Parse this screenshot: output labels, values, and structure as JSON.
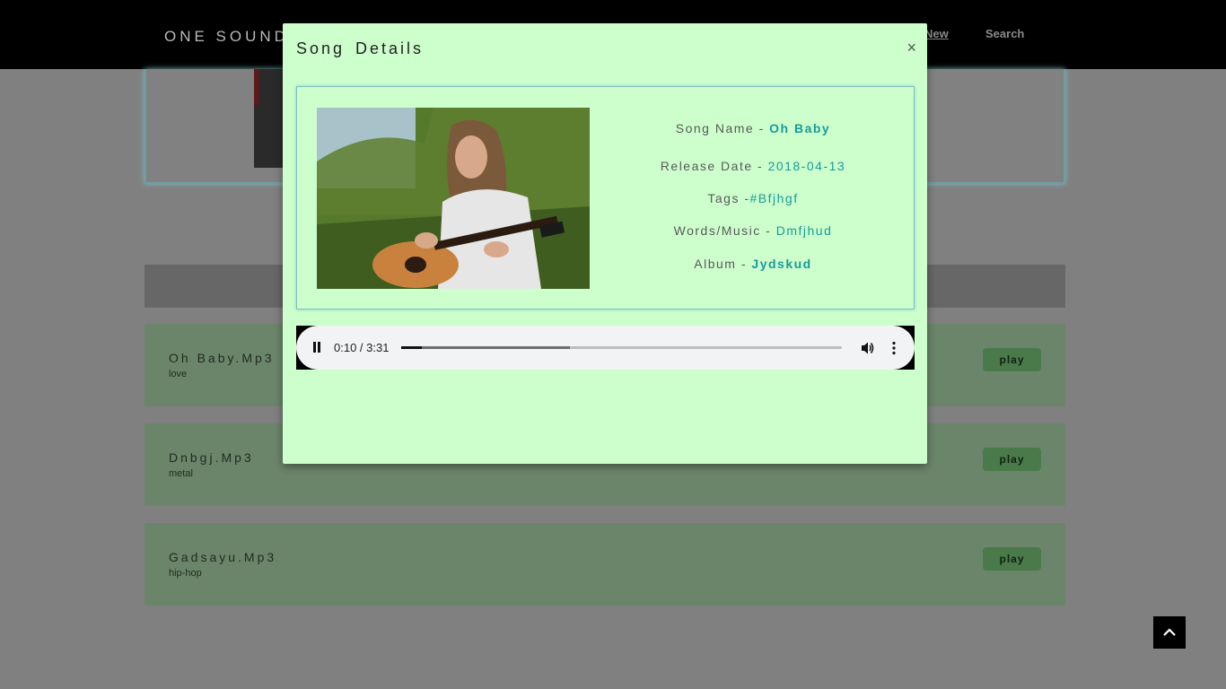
{
  "navbar": {
    "brand": "ONE SOUND",
    "links": [
      "New",
      "Search"
    ]
  },
  "songs": [
    {
      "title": "Oh   Baby.Mp3",
      "tag": "love",
      "button": "play"
    },
    {
      "title": "Dnbgj.Mp3",
      "tag": "metal",
      "button": "play"
    },
    {
      "title": "Gadsayu.Mp3",
      "tag": "hip-hop",
      "button": "play"
    }
  ],
  "modal": {
    "title": "Song  Details",
    "close": "×",
    "song_name_label": "Song Name - ",
    "song_name": "Oh Baby",
    "release_label": "Release Date - ",
    "release_date": "2018-04-13",
    "tags_label": "Tags -",
    "tags": "#Bfjhgf",
    "words_label": "Words/Music - ",
    "words_music": "Dmfjhud",
    "album_label": "Album - ",
    "album": "Jydskud"
  },
  "player": {
    "time": "0:10 / 3:31",
    "progress_fraction": 0.047,
    "buffered_fraction": 0.382
  },
  "icons": {
    "pause": "pause-icon",
    "volume": "volume-icon",
    "more": "more-vert-icon",
    "to_top": "chevron-up-icon"
  },
  "colors": {
    "modal_bg": "#ccffcc",
    "accent": "#1a9a9a",
    "song_row": "#6b856b",
    "play_button": "#4a7a4a"
  }
}
